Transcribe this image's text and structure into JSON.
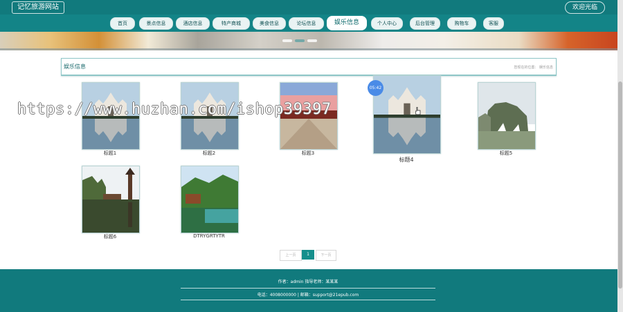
{
  "header": {
    "site_title": "记忆旅游网站",
    "welcome": "欢迎光临"
  },
  "nav": {
    "items": [
      {
        "label": "首页"
      },
      {
        "label": "景点信息"
      },
      {
        "label": "酒店信息"
      },
      {
        "label": "特产商城"
      },
      {
        "label": "美食信息"
      },
      {
        "label": "论坛信息"
      },
      {
        "label": "娱乐信息"
      },
      {
        "label": "个人中心"
      },
      {
        "label": "后台管理"
      },
      {
        "label": "购物车"
      },
      {
        "label": "客服"
      }
    ],
    "active": "娱乐信息"
  },
  "section": {
    "title": "娱乐信息",
    "location_label": "您现在的位置：",
    "location_value": "娱乐信息"
  },
  "items": [
    {
      "title": "标题1"
    },
    {
      "title": "标题2"
    },
    {
      "title": "标题3"
    },
    {
      "title": "标题4"
    },
    {
      "title": "标题5"
    },
    {
      "title": "标题6"
    },
    {
      "title": "DTRYGRTYTR"
    }
  ],
  "pagination": {
    "prev": "上一页",
    "current": "1",
    "next": "下一页"
  },
  "footer": {
    "author_line": "作者：admin  指导老师：某某某",
    "contact_line": "电话：4008000000 | 邮箱：support@21epub.com"
  },
  "overlay": {
    "watermark": "https://www.huzhan.com/ishop39397",
    "time_badge": "05:42"
  },
  "colors": {
    "brand": "#117a7d",
    "nav_bar": "#138487",
    "active_page": "#168f8c"
  }
}
